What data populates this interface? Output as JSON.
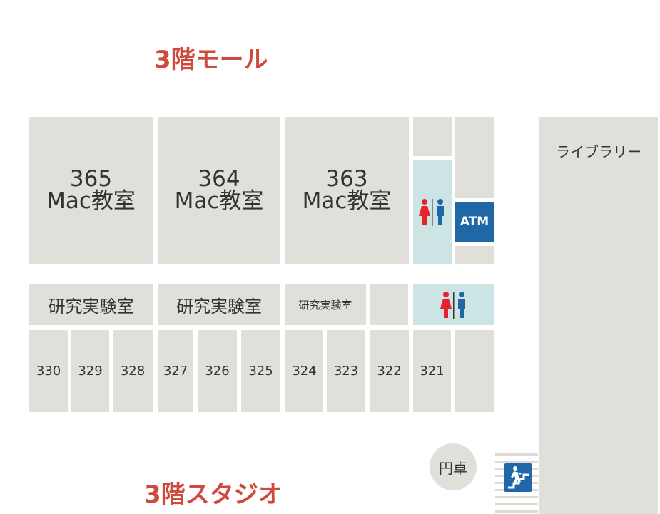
{
  "titles": {
    "mall": "3階モール",
    "studio": "3階スタジオ"
  },
  "library": "ライブラリー",
  "mac_rooms": [
    {
      "number": "365",
      "label": "Mac教室"
    },
    {
      "number": "364",
      "label": "Mac教室"
    },
    {
      "number": "363",
      "label": "Mac教室"
    }
  ],
  "labs": [
    "研究実験室",
    "研究実験室",
    "研究実験室"
  ],
  "rooms": [
    "330",
    "329",
    "328",
    "327",
    "326",
    "325",
    "324",
    "323",
    "322",
    "321"
  ],
  "atm": "ATM",
  "round_table": "円卓",
  "icons": {
    "restroom": "restroom-icon",
    "stairs": "stairs-icon"
  },
  "colors": {
    "title": "#cf4a3c",
    "room": "#e0dfd9",
    "restroom": "#cde4e4",
    "atm": "#1f67a7",
    "female": "#e8222b",
    "male": "#1f67a7"
  }
}
